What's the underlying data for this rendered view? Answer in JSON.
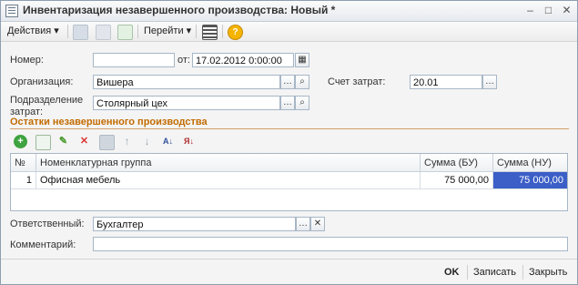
{
  "window": {
    "title": "Инвентаризация незавершенного производства: Новый *",
    "minimize": "–",
    "maximize": "□",
    "close": "✕"
  },
  "toolbar": {
    "actions": "Действия",
    "goto": "Перейти",
    "help": "?"
  },
  "form": {
    "number_label": "Номер:",
    "number_value": "",
    "from_label": "от:",
    "date_value": "17.02.2012  0:00:00",
    "org_label": "Организация:",
    "org_value": "Вишера",
    "account_label": "Счет затрат:",
    "account_value": "20.01",
    "dept_label": "Подразделение затрат:",
    "dept_value": "Столярный цех"
  },
  "section": {
    "title": "Остатки незавершенного производства"
  },
  "table": {
    "columns": [
      "№",
      "Номенклатурная группа",
      "Сумма (БУ)",
      "Сумма (НУ)"
    ],
    "rows": [
      {
        "n": "1",
        "group": "Офисная мебель",
        "sum_bu": "75 000,00",
        "sum_nu": "75 000,00"
      }
    ]
  },
  "bottom": {
    "responsible_label": "Ответственный:",
    "responsible_value": "Бухгалтер",
    "comment_label": "Комментарий:",
    "comment_value": ""
  },
  "footer": {
    "ok": "OK",
    "save": "Записать",
    "close": "Закрыть"
  },
  "colors": {
    "accent": "#c26b00",
    "selected": "#3b5ec7"
  }
}
